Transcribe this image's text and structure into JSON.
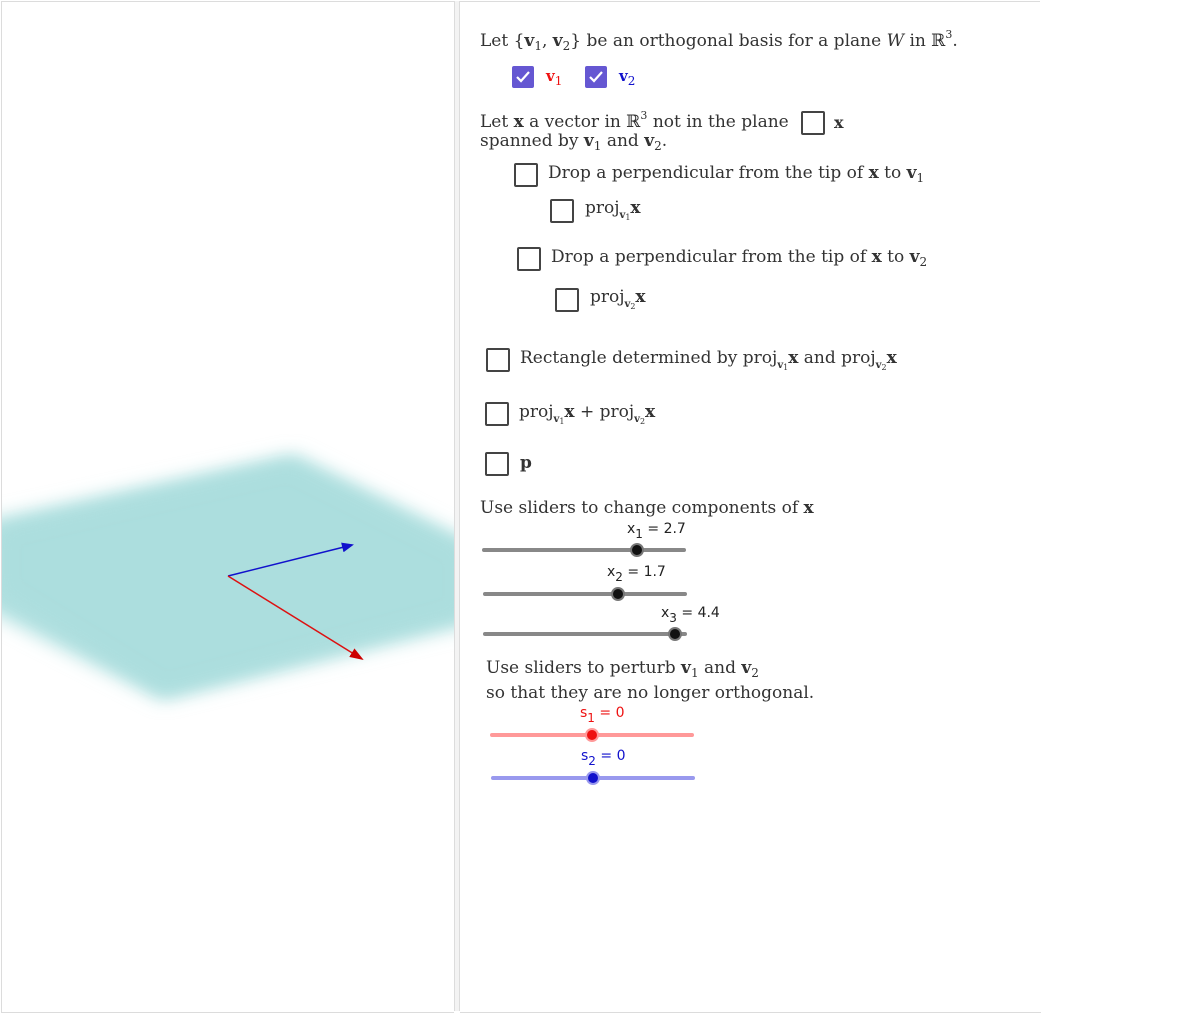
{
  "colors": {
    "v1": "#ee1111",
    "v2": "#1111cc",
    "plane": "#b0e0e0",
    "checkbox_checked": "#6557d2",
    "slider_gray": "#888888",
    "slider_red": "#ff9999",
    "slider_blue": "#9999ee"
  },
  "header": {
    "text_let": "Let",
    "set_open": "{",
    "v": "v",
    "sub1": "1",
    "sub2": "2",
    "comma": ", ",
    "set_close": "}",
    "middle": "be an orthogonal basis for a plane",
    "W": "W",
    "in": "in",
    "R": "ℝ",
    "exp": "3",
    "period": "."
  },
  "toggles": {
    "v1": {
      "checked": true,
      "label": "v",
      "sub": "1"
    },
    "v2": {
      "checked": true,
      "label": "v",
      "sub": "2"
    }
  },
  "x_intro": {
    "line1_a": "Let",
    "x": "x",
    "line1_b": "a vector in",
    "R": "ℝ",
    "exp": "3",
    "line1_c": "not in the plane",
    "line2_a": "spanned by",
    "and": "and",
    "v": "v",
    "sub1": "1",
    "sub2": "2",
    "period": "."
  },
  "x_toggle": {
    "checked": false,
    "label": "x"
  },
  "options": {
    "perp_v1": {
      "checked": false,
      "text": "Drop a perpendicular from the tip of",
      "x": "x",
      "to": "to",
      "v": "v",
      "sub": "1"
    },
    "proj_v1": {
      "checked": false,
      "proj": "proj",
      "v": "v",
      "sub": "1",
      "x": "x"
    },
    "perp_v2": {
      "checked": false,
      "text": "Drop a perpendicular from the tip of",
      "x": "x",
      "to": "to",
      "v": "v",
      "sub": "2"
    },
    "proj_v2": {
      "checked": false,
      "proj": "proj",
      "v": "v",
      "sub": "2",
      "x": "x"
    },
    "rectangle": {
      "checked": false,
      "text": "Rectangle determined by",
      "proj": "proj",
      "v": "v",
      "sub1": "1",
      "sub2": "2",
      "x": "x",
      "and": "and"
    },
    "sum": {
      "checked": false,
      "proj": "proj",
      "v": "v",
      "sub1": "1",
      "sub2": "2",
      "x": "x",
      "plus": "+"
    },
    "p": {
      "checked": false,
      "label": "p"
    }
  },
  "sliders_x": {
    "heading_a": "Use sliders to change components of",
    "heading_x": "x",
    "items": [
      {
        "name": "x",
        "sub": "1",
        "eq": " = ",
        "value": "2.7",
        "fraction": 0.76
      },
      {
        "name": "x",
        "sub": "2",
        "eq": " = ",
        "value": "1.7",
        "fraction": 0.66
      },
      {
        "name": "x",
        "sub": "3",
        "eq": " = ",
        "value": "4.4",
        "fraction": 0.94
      }
    ]
  },
  "sliders_s": {
    "heading_line1_a": "Use sliders to perturb",
    "heading_and": "and",
    "v": "v",
    "sub1": "1",
    "sub2": "2",
    "heading_line2": "so that they are no longer orthogonal.",
    "items": [
      {
        "name": "s",
        "sub": "1",
        "eq": " = ",
        "value": "0",
        "fraction": 0.5
      },
      {
        "name": "s",
        "sub": "2",
        "eq": " = ",
        "value": "0",
        "fraction": 0.5
      }
    ]
  }
}
